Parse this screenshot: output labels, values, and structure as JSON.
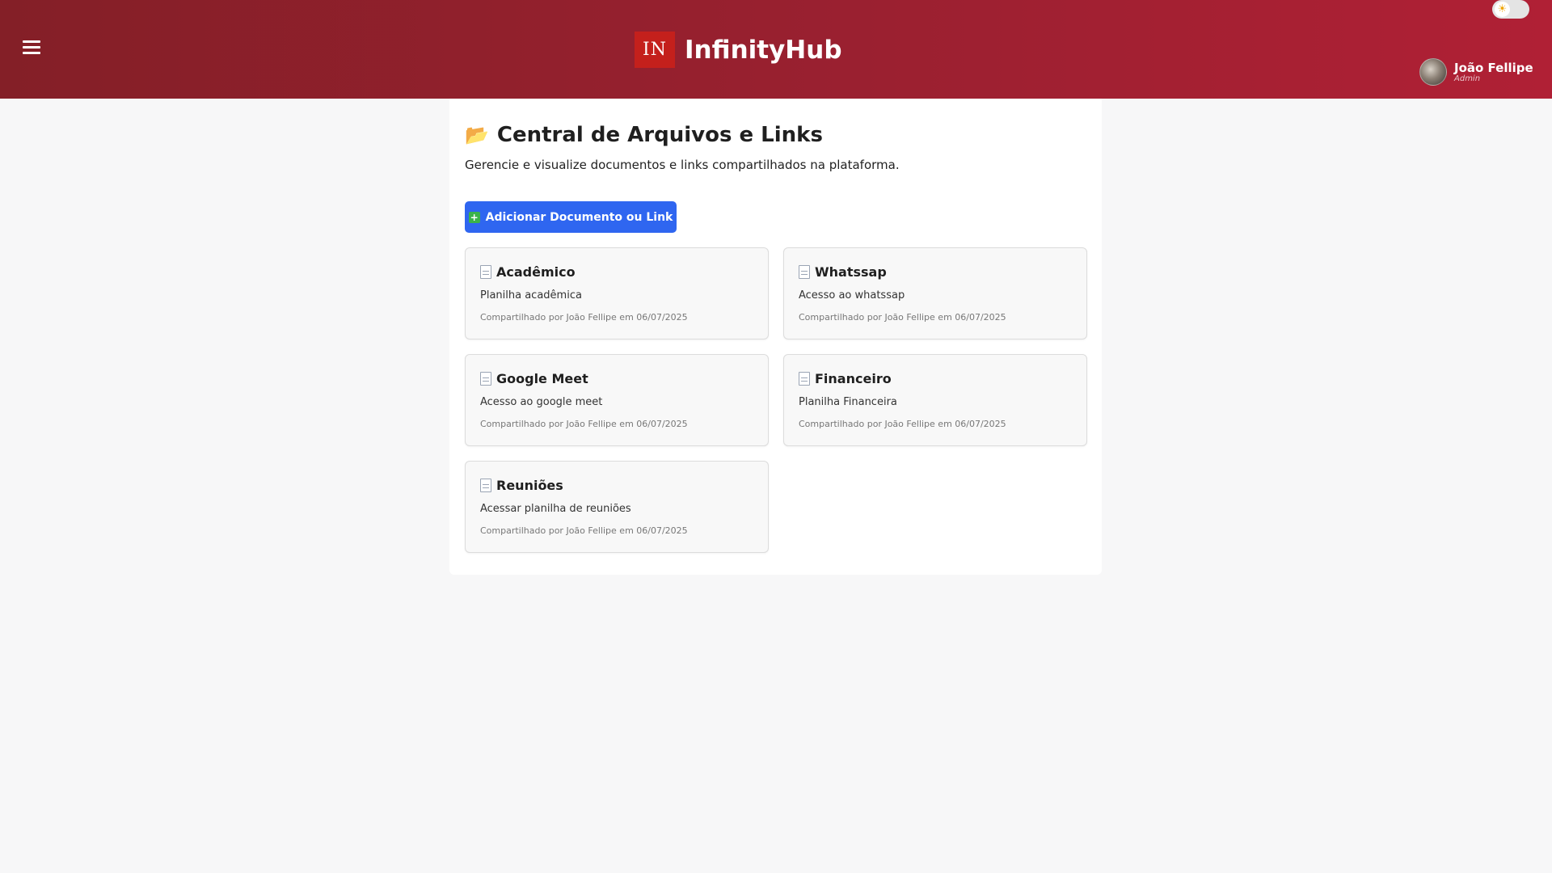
{
  "header": {
    "menu_icon": "hamburger-menu-icon",
    "logo_text": "IN",
    "app_title": "InfinityHub",
    "theme_toggle_icon": "sun-icon",
    "user": {
      "name": "João Fellipe",
      "role": "Admin"
    }
  },
  "page": {
    "title_icon": "open-folder-icon",
    "title": "Central de Arquivos e Links",
    "subtitle": "Gerencie e visualize documentos e links compartilhados na plataforma.",
    "add_button_label": "Adicionar Documento ou Link",
    "add_button_icon": "plus-icon"
  },
  "cards": [
    {
      "title": "Acadêmico",
      "description": "Planilha acadêmica",
      "meta": "Compartilhado por João Fellipe em 06/07/2025"
    },
    {
      "title": "Whatssap",
      "description": "Acesso ao whatssap",
      "meta": "Compartilhado por João Fellipe em 06/07/2025"
    },
    {
      "title": "Google Meet",
      "description": "Acesso ao google meet",
      "meta": "Compartilhado por João Fellipe em 06/07/2025"
    },
    {
      "title": "Financeiro",
      "description": "Planilha Financeira",
      "meta": "Compartilhado por João Fellipe em 06/07/2025"
    },
    {
      "title": "Reuniões",
      "description": "Acessar planilha de reuniões",
      "meta": "Compartilhado por João Fellipe em 06/07/2025"
    }
  ],
  "colors": {
    "header_start": "#841f27",
    "header_end": "#b02035",
    "logo_bg": "#c4201c",
    "primary_button": "#2f66f0"
  }
}
